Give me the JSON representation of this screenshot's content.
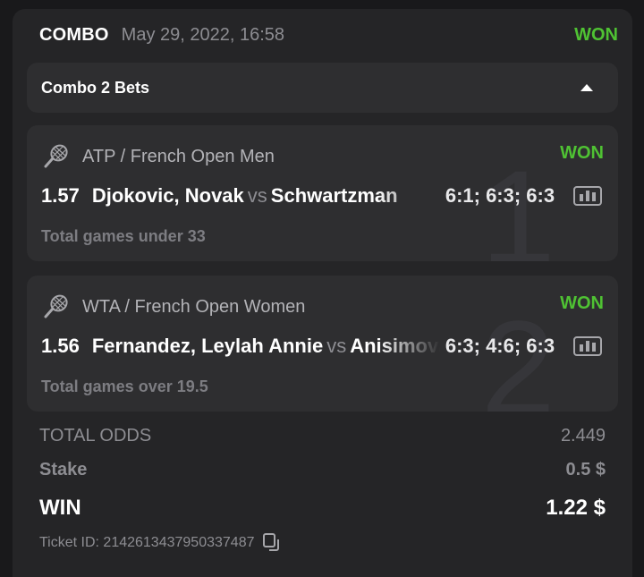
{
  "header": {
    "type": "COMBO",
    "date": "May 29, 2022, 16:58",
    "status": "WON"
  },
  "combo": {
    "label": "Combo 2 Bets"
  },
  "bets": [
    {
      "index": "1",
      "league": "ATP / French Open Men",
      "status": "WON",
      "odds": "1.57",
      "home": "Djokovic, Novak",
      "vs": "vs",
      "away": "Schwartzman",
      "score": "6:1; 6:3; 6:3",
      "market": "Total games under 33"
    },
    {
      "index": "2",
      "league": "WTA / French Open Women",
      "status": "WON",
      "odds": "1.56",
      "home": "Fernandez, Leylah Annie",
      "vs": "vs",
      "away": "Anisimova",
      "score": "6:3; 4:6; 6:3",
      "market": "Total games over 19.5"
    }
  ],
  "summary": {
    "total_odds_label": "TOTAL ODDS",
    "total_odds_value": "2.449",
    "stake_label": "Stake",
    "stake_value": "0.5 $",
    "win_label": "WIN",
    "win_value": "1.22 $",
    "ticket_label": "Ticket ID: 2142613437950337487"
  },
  "colors": {
    "accent_won": "#4fc233",
    "background": "#19191b",
    "card": "#252527",
    "panel": "#2e2e30"
  },
  "icons": [
    "tennis-racket-icon",
    "stats-icon",
    "caret-up-icon",
    "copy-icon"
  ]
}
